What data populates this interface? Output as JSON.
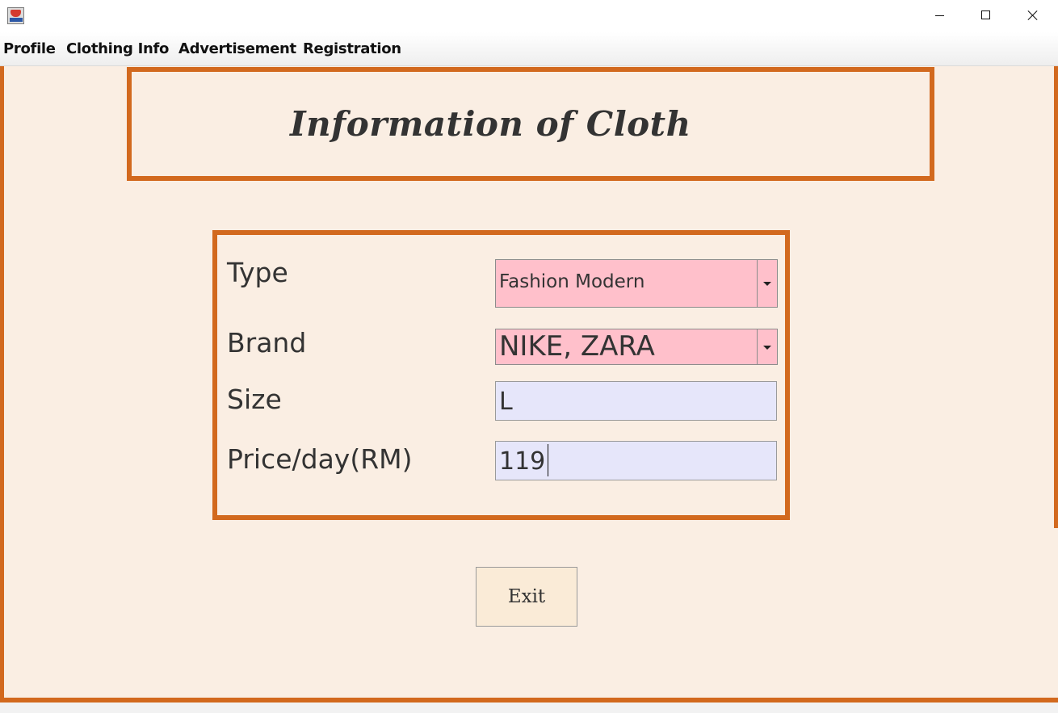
{
  "window": {
    "controls": {
      "minimize_icon": "minimize-icon",
      "maximize_icon": "maximize-icon",
      "close_icon": "close-icon"
    }
  },
  "menubar": {
    "items": [
      {
        "label": "Profile"
      },
      {
        "label": "Clothing Info"
      },
      {
        "label": "Advertisement"
      },
      {
        "label": "Registration"
      }
    ]
  },
  "header": {
    "title": "Information of Cloth"
  },
  "form": {
    "type": {
      "label": "Type",
      "selected": "Fashion Modern"
    },
    "brand": {
      "label": "Brand",
      "selected": "NIKE, ZARA"
    },
    "size": {
      "label": "Size",
      "value": "L"
    },
    "price": {
      "label": "Price/day(RM)",
      "value": "119"
    }
  },
  "actions": {
    "exit_label": "Exit"
  },
  "colors": {
    "accent_border": "#d2691e",
    "background": "#faeee3",
    "combo_background": "#ffc0cb",
    "textfield_background": "#e6e6fa",
    "button_background": "#faebd7"
  }
}
